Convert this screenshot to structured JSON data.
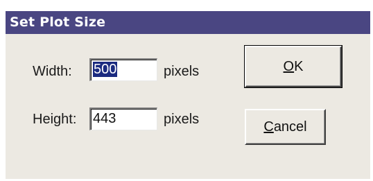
{
  "dialog": {
    "title": "Set Plot Size",
    "width_label": "Width:",
    "width_value": "500",
    "width_unit": "pixels",
    "height_label": "Height:",
    "height_value": "443",
    "height_unit": "pixels",
    "ok_mnemonic": "O",
    "ok_rest": "K",
    "cancel_mnemonic": "C",
    "cancel_rest": "ancel"
  }
}
